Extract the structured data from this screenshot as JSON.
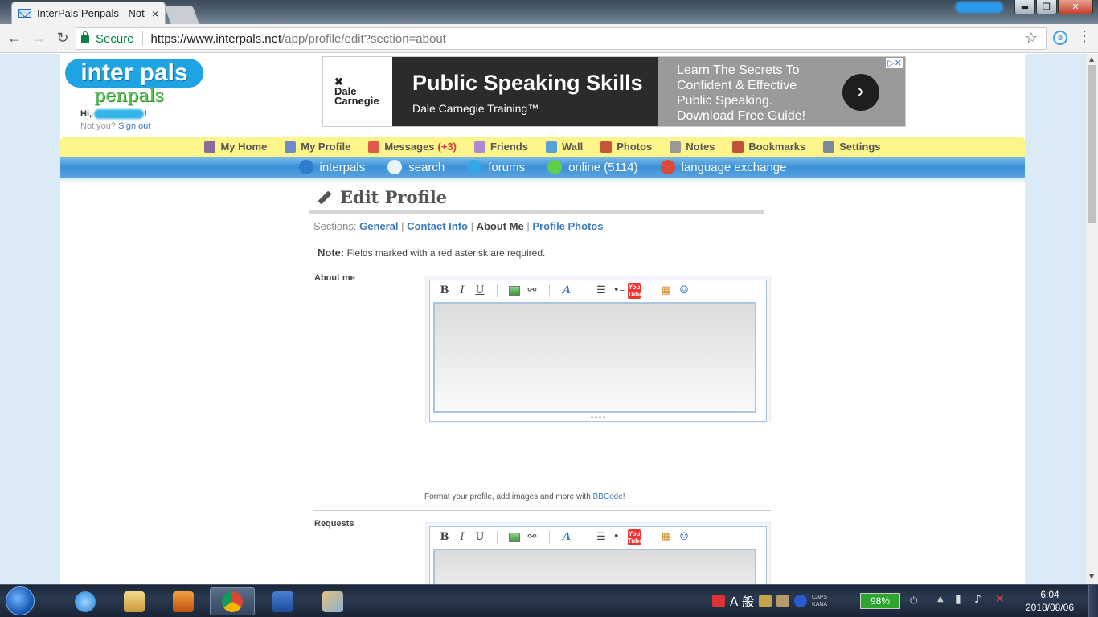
{
  "browser": {
    "tab_title": "InterPals Penpals - Not",
    "tab_close": "×",
    "security_label": "Secure",
    "url_host": "https://www.interpals.net",
    "url_path": "/app/profile/edit?section=about",
    "window_buttons": {
      "minimize": "▬",
      "maximize": "❐",
      "close": "✕"
    }
  },
  "site": {
    "logo_top": "inter pals",
    "logo_bottom": "penpals",
    "greeting_prefix": "Hi, ",
    "greeting_suffix": "!",
    "not_you": "Not you?",
    "sign_out": "Sign out"
  },
  "ad": {
    "brand": "Dale Carnegie",
    "headline": "Public Speaking Skills",
    "subline": "Dale Carnegie Training™",
    "pitch": "Learn The Secrets To Confident & Effective Public Speaking. Download Free Guide!",
    "cta_icon": "›",
    "choices": "▷✕"
  },
  "nav_primary": [
    {
      "label": "My Home",
      "icon": "home-icon",
      "color": "#8a6b9a"
    },
    {
      "label": "My Profile",
      "icon": "profile-icon",
      "color": "#6b8cc7"
    },
    {
      "label": "Messages",
      "icon": "envelope-icon",
      "color": "#e05a4a",
      "count": "(+3)"
    },
    {
      "label": "Friends",
      "icon": "friends-icon",
      "color": "#b08ad0"
    },
    {
      "label": "Wall",
      "icon": "wall-icon",
      "color": "#5aa0d8"
    },
    {
      "label": "Photos",
      "icon": "photos-icon",
      "color": "#c8553a"
    },
    {
      "label": "Notes",
      "icon": "notes-icon",
      "color": "#999999"
    },
    {
      "label": "Bookmarks",
      "icon": "bookmarks-icon",
      "color": "#c0503a"
    },
    {
      "label": "Settings",
      "icon": "settings-icon",
      "color": "#7a8a9a"
    }
  ],
  "nav_secondary": [
    {
      "label": "interpals",
      "icon": "globe-icon",
      "color": "#2e7bd0"
    },
    {
      "label": "search",
      "icon": "magnifier-icon",
      "color": "#e9f3fb"
    },
    {
      "label": "forums",
      "icon": "speech-bubble-icon",
      "color": "#34a7e6"
    },
    {
      "label": "online (5114)",
      "icon": "online-users-icon",
      "color": "#5fcf4a"
    },
    {
      "label": "language exchange",
      "icon": "flags-icon",
      "color": "#d94a3a"
    }
  ],
  "page": {
    "title": "Edit Profile",
    "sections_label": "Sections:",
    "sections": [
      "General",
      "Contact Info",
      "About Me",
      "Profile Photos"
    ],
    "current_section": "About Me",
    "note_label": "Note:",
    "note_text": "Fields marked with a red asterisk are required."
  },
  "fields": [
    {
      "label": "About me",
      "value": "",
      "hint_text": "Format your profile, add images and more with ",
      "hint_link": "BBCode",
      "hint_end": "!"
    },
    {
      "label": "Requests",
      "value": ""
    }
  ],
  "editor_toolbar": {
    "bold": "B",
    "italic": "I",
    "underline": "U",
    "font": "A",
    "youtube": "You Tube"
  },
  "taskbar": {
    "ime": "A 般",
    "caps": "CAPS",
    "kana": "KANA",
    "battery": "98%",
    "time": "6:04",
    "date": "2018/08/06"
  }
}
